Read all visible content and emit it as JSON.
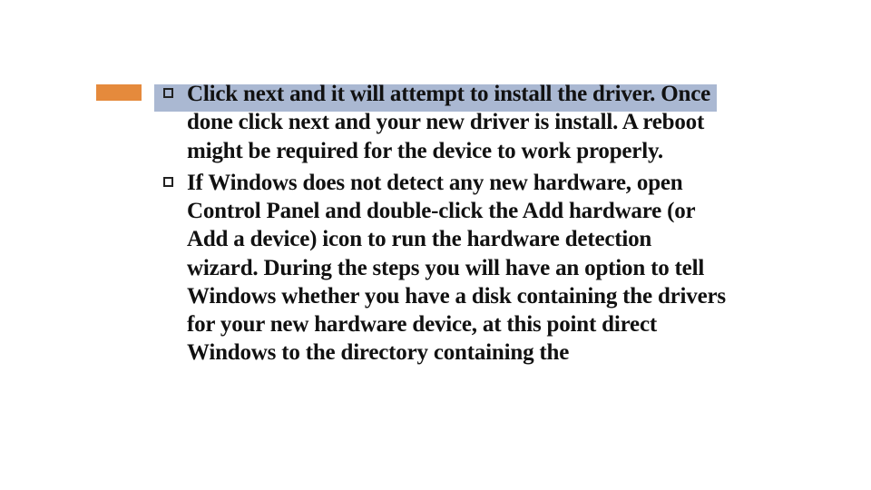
{
  "slide": {
    "bullets": [
      "Click next and it will attempt to install the driver. Once done click next and your new driver is install. A reboot might be required for the device to work properly.",
      "If Windows does not detect any new hardware, open Control Panel and double-click the Add hardware (or Add a device) icon to run the hardware detection wizard. During the steps you will have an option to tell Windows whether you have a disk containing the drivers for your new hardware device, at this point direct Windows to the directory containing the"
    ]
  },
  "colors": {
    "accent": "#e58a3c",
    "highlight": "#aab8d2"
  }
}
